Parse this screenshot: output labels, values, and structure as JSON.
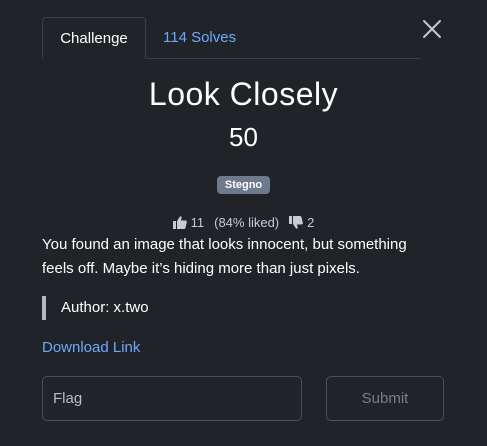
{
  "tabs": [
    {
      "label": "Challenge",
      "active": true
    },
    {
      "label": "114 Solves",
      "active": false
    }
  ],
  "challenge": {
    "name": "Look Closely",
    "value": "50",
    "tag": "Stegno",
    "description": "You found an image that looks innocent, but something feels off. Maybe it’s hiding more than just pixels.",
    "author": "Author: x.two",
    "download_label": "Download Link"
  },
  "votes": {
    "likes": "11",
    "liked_percent": "(84% liked)",
    "dislikes": "2"
  },
  "form": {
    "flag_placeholder": "Flag",
    "flag_value": "",
    "submit_label": "Submit"
  },
  "icons": {
    "close": "close-icon",
    "like": "thumbs-up-icon",
    "dislike": "thumbs-down-icon"
  },
  "colors": {
    "background": "#202327",
    "link": "#6ea8fe",
    "tag_background": "#6c7a8b",
    "border": "#3a3f44"
  }
}
